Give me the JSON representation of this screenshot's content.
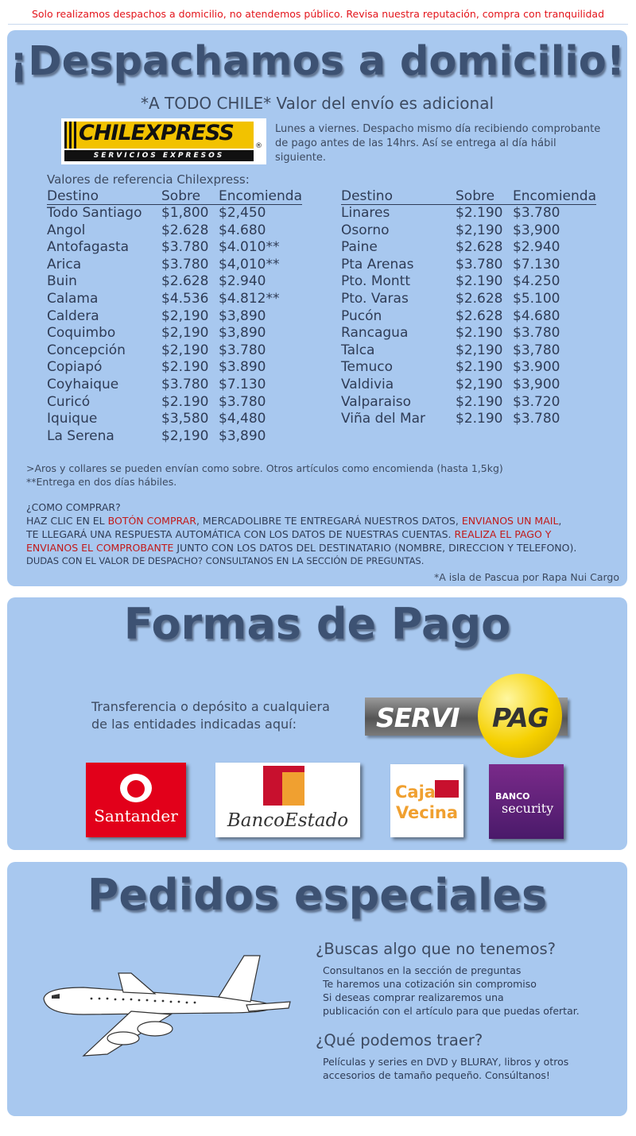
{
  "topbar": {
    "text": "Solo realizamos despachos a domicilio, no atendemos público. Revisa nuestra reputación, compra con tranquilidad"
  },
  "shipping": {
    "title": "¡Despachamos a domicilio!",
    "subtitle": "*A TODO CHILE* Valor del envío es adicional",
    "logo": {
      "word": "CHILEXPRESS",
      "tagline": "SERVICIOS EXPRESOS",
      "reg": "®"
    },
    "delivery_note": "Lunes a viernes. Despacho mismo día recibiendo comprobante de pago antes de las 14hrs. Así se entrega al día hábil siguiente.",
    "ref_caption": "Valores de referencia Chilexpress:",
    "headers": {
      "destino": "Destino",
      "sobre": "Sobre",
      "encomienda": "Encomienda"
    },
    "rates_left": [
      {
        "destino": "Todo Santiago",
        "sobre": "$1,800",
        "encomienda": "$2,450"
      },
      {
        "destino": "Angol",
        "sobre": "$2.628",
        "encomienda": "$4.680"
      },
      {
        "destino": "Antofagasta",
        "sobre": "$3.780",
        "encomienda": "$4.010**"
      },
      {
        "destino": "Arica",
        "sobre": "$3.780",
        "encomienda": "$4,010**"
      },
      {
        "destino": "Buin",
        "sobre": "$2.628",
        "encomienda": "$2.940"
      },
      {
        "destino": "Calama",
        "sobre": "$4.536",
        "encomienda": "$4.812**"
      },
      {
        "destino": "Caldera",
        "sobre": "$2,190",
        "encomienda": "$3,890"
      },
      {
        "destino": "Coquimbo",
        "sobre": "$2,190",
        "encomienda": "$3,890"
      },
      {
        "destino": "Concepción",
        "sobre": "$2,190",
        "encomienda": "$3.780"
      },
      {
        "destino": "Copiapó",
        "sobre": "$2.190",
        "encomienda": "$3.890"
      },
      {
        "destino": "Coyhaique",
        "sobre": "$3.780",
        "encomienda": "$7.130"
      },
      {
        "destino": "Curicó",
        "sobre": "$2.190",
        "encomienda": "$3.780"
      },
      {
        "destino": "Iquique",
        "sobre": "$3,580",
        "encomienda": "$4,480"
      },
      {
        "destino": "La Serena",
        "sobre": "$2,190",
        "encomienda": "$3,890"
      }
    ],
    "rates_right": [
      {
        "destino": "Linares",
        "sobre": "$2.190",
        "encomienda": "$3.780"
      },
      {
        "destino": "Osorno",
        "sobre": "$2,190",
        "encomienda": "$3,900"
      },
      {
        "destino": "Paine",
        "sobre": "$2.628",
        "encomienda": "$2.940"
      },
      {
        "destino": "Pta Arenas",
        "sobre": "$3.780",
        "encomienda": "$7.130"
      },
      {
        "destino": "Pto. Montt",
        "sobre": "$2.190",
        "encomienda": "$4.250"
      },
      {
        "destino": "Pto. Varas",
        "sobre": "$2.628",
        "encomienda": "$5.100"
      },
      {
        "destino": "Pucón",
        "sobre": "$2.628",
        "encomienda": "$4.680"
      },
      {
        "destino": "Rancagua",
        "sobre": "$2.190",
        "encomienda": "$3.780"
      },
      {
        "destino": "Talca",
        "sobre": "$2,190",
        "encomienda": "$3,780"
      },
      {
        "destino": "Temuco",
        "sobre": "$2.190",
        "encomienda": "$3.900"
      },
      {
        "destino": "Valdivia",
        "sobre": "$2,190",
        "encomienda": "$3,900"
      },
      {
        "destino": "Valparaiso",
        "sobre": "$2.190",
        "encomienda": "$3.720"
      },
      {
        "destino": "Viña del Mar",
        "sobre": "$2.190",
        "encomienda": "$3.780"
      }
    ],
    "note1": ">Aros y collares se pueden envían como sobre. Otros artículos como encomienda (hasta 1,5kg)",
    "note2": "**Entrega en dos días hábiles.",
    "how": {
      "heading": "¿COMO COMPRAR?",
      "p1": "HAZ CLIC EN EL ",
      "r1": "BOTÓN COMPRAR",
      "p2": ", MERCADOLIBRE TE ENTREGARÁ NUESTROS DATOS, ",
      "r2": "ENVIANOS UN MAIL",
      "p3": ",",
      "p4": "TE LLEGARÁ UNA RESPUESTA AUTOMÁTICA CON LOS DATOS DE NUESTRAS CUENTAS. ",
      "r3": "REALIZA EL PAGO Y",
      "r4": "ENVIANOS EL COMPROBANTE",
      "p5": " JUNTO CON LOS DATOS DEL DESTINATARIO (NOMBRE, DIRECCION Y TELEFONO).",
      "p6": "DUDAS CON EL VALOR DE DESPACHO? CONSULTANOS EN LA SECCIÓN DE PREGUNTAS."
    },
    "pascua": "*A isla de Pascua por Rapa Nui Cargo"
  },
  "payment": {
    "title": "Formas de Pago",
    "text_line1": "Transferencia o depósito a cualquiera",
    "text_line2": "de las entidades indicadas aquí:",
    "servipag": {
      "serv": "SERVI",
      "pag": "PAG"
    },
    "banks": {
      "santander": "Santander",
      "bancoestado": "BancoEstado",
      "cajavecina1": "Caja",
      "cajavecina2": "Vecina",
      "security1": "BANCO",
      "security2": "security"
    }
  },
  "special": {
    "title": "Pedidos especiales",
    "q1": "¿Buscas algo que no tenemos?",
    "q1_lines": [
      "Consultanos en la sección de preguntas",
      "Te haremos una cotización sin compromiso",
      "Si deseas comprar realizaremos una",
      "publicación con el artículo para que puedas ofertar."
    ],
    "q2": "¿Qué podemos traer?",
    "q2_lines": [
      "Películas y series en DVD y BLURAY, libros y otros",
      "accesorios de tamaño pequeño. Consúltanos!"
    ]
  }
}
